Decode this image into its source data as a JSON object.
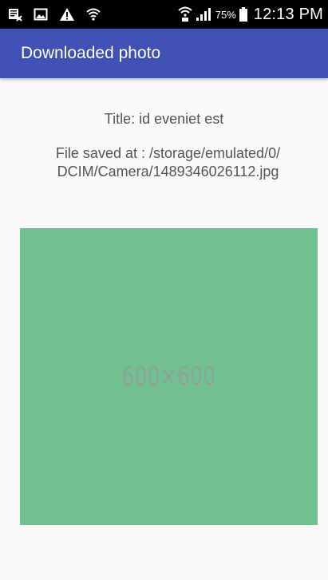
{
  "status_bar": {
    "battery_percent": "75%",
    "time": "12:13 PM",
    "icons": [
      "notification-x-icon",
      "image-icon",
      "warning-icon",
      "wifi-icon",
      "wifi-calling-icon",
      "signal-icon",
      "battery-icon"
    ]
  },
  "app_bar": {
    "title": "Downloaded photo",
    "color": "#3f51b5"
  },
  "content": {
    "title_line": "Title: id eveniet est",
    "file_line": "File saved at : /storage/emulated/0/\nDCIM/Camera/1489346026112.jpg"
  },
  "photo": {
    "label": "600×600",
    "color": "#72bf90"
  }
}
